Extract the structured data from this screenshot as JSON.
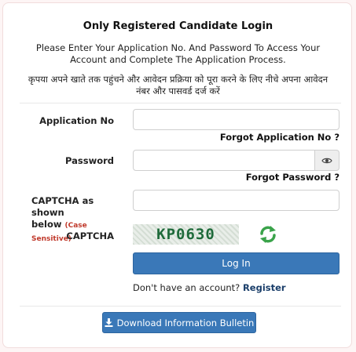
{
  "heading": "Only Registered Candidate Login",
  "info_en": "Please Enter Your Application No. And Password To Access Your Account and Complete The Application Process.",
  "info_hi_line1": "कृपया अपने खाते तक पहुंचने और आवेदन प्रक्रिया को पूरा करने के लिए नीचे अपना आवेदन",
  "info_hi_line2": "नंबर और पासवर्ड दर्ज करें",
  "form": {
    "application_no_label": "Application No",
    "application_no_value": "",
    "forgot_application": "Forgot Application No ?",
    "password_label": "Password",
    "password_value": "",
    "forgot_password": "Forgot Password ?",
    "captcha_input_label_line1": "CAPTCHA as shown",
    "captcha_input_label_line2": "below",
    "case_sensitive": "(Case Sensitive)",
    "captcha_value": "",
    "captcha_label": "CAPTCHA",
    "captcha_text": "KP0630",
    "login_button": "Log In",
    "no_account_text": "Don't have an account?",
    "register_link": "Register"
  },
  "download_button": "Download Information Bulletin",
  "icons": {
    "eye": "eye-icon",
    "refresh": "refresh-icon",
    "download": "download-icon"
  },
  "colors": {
    "primary_button": "#3a78b8",
    "case_sensitive": "#c0392b",
    "refresh_green": "#3aa34a"
  }
}
